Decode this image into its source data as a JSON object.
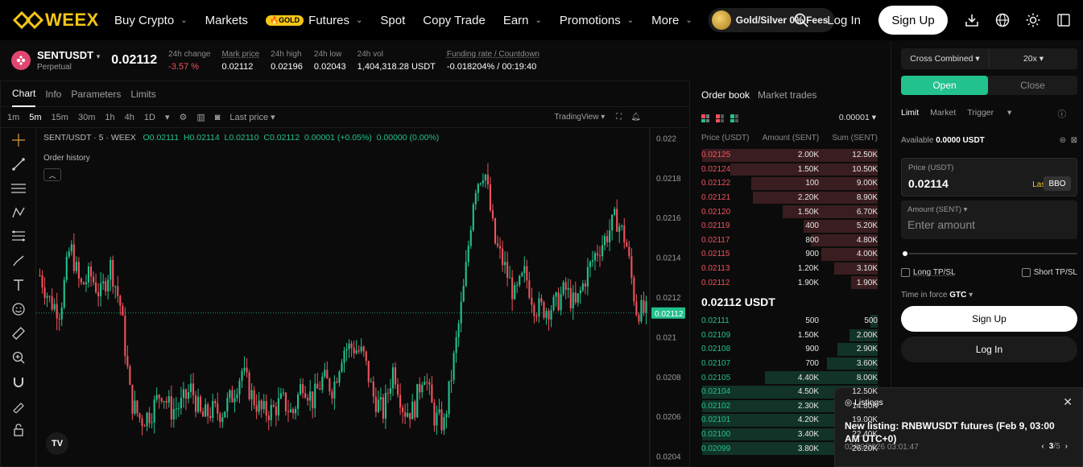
{
  "nav": {
    "logo": "WEEX",
    "items": [
      {
        "label": "Buy Crypto",
        "chevron": true
      },
      {
        "label": "Markets",
        "chevron": false
      },
      {
        "label": "Futures",
        "chevron": true,
        "badge": "🔥GOLD"
      },
      {
        "label": "Spot",
        "chevron": false
      },
      {
        "label": "Copy Trade",
        "chevron": false
      },
      {
        "label": "Earn",
        "chevron": true
      },
      {
        "label": "Promotions",
        "chevron": true
      },
      {
        "label": "More",
        "chevron": true
      }
    ],
    "promo": "Gold/Silver 0% Fees",
    "login": "Log In",
    "signup": "Sign Up"
  },
  "ticker": {
    "symbol": "SENTUSDT",
    "type": "Perpetual",
    "price": "0.02112",
    "stats": [
      {
        "label": "24h change",
        "value": "-3.57 %",
        "red": true
      },
      {
        "label": "Mark price",
        "value": "0.02112"
      },
      {
        "label": "24h high",
        "value": "0.02196"
      },
      {
        "label": "24h low",
        "value": "0.02043"
      },
      {
        "label": "24h vol",
        "value": "1,404,318.28 USDT"
      },
      {
        "label": "Funding rate / Countdown",
        "value": "-0.018204% / 00:19:40"
      }
    ]
  },
  "chart_tabs": [
    "Chart",
    "Info",
    "Parameters",
    "Limits"
  ],
  "timeframes": [
    "1m",
    "5m",
    "15m",
    "30m",
    "1h",
    "4h",
    "1D"
  ],
  "active_timeframe": "5m",
  "last_price_label": "Last price",
  "tradingview_label": "TradingView",
  "ohlc": {
    "title": "SENT/USDT · 5 · WEEX",
    "o": "O0.02111",
    "h": "H0.02114",
    "l": "L0.02110",
    "c": "C0.02112",
    "chg": "0.00001 (+0.05%)",
    "vol": "0.00000 (0.00%)"
  },
  "order_history_label": "Order history",
  "tv_logo": "TV",
  "chart_data": {
    "type": "candlestick",
    "yticks": [
      "0.022",
      "0.0218",
      "0.0216",
      "0.0214",
      "0.0212",
      "0.021",
      "0.0208",
      "0.0206",
      "0.0204"
    ],
    "ylim": [
      0.02035,
      0.02205
    ],
    "current_price": "0.02112",
    "current_value": 0.02112,
    "colors": {
      "up": "#22c18e",
      "down": "#f0525c"
    },
    "path": [
      0.02131,
      0.02118,
      0.02113,
      0.02146,
      0.02125,
      0.02131,
      0.02121,
      0.02136,
      0.02115,
      0.02068,
      0.02058,
      0.02062,
      0.02073,
      0.02063,
      0.02066,
      0.02074,
      0.02059,
      0.02063,
      0.02062,
      0.0207,
      0.02083,
      0.0207,
      0.02062,
      0.02063,
      0.02068,
      0.02061,
      0.02078,
      0.02068,
      0.02079,
      0.02074,
      0.02094,
      0.02095,
      0.02091,
      0.0207,
      0.02062,
      0.02085,
      0.02063,
      0.02063,
      0.02084,
      0.0206,
      0.02056,
      0.0209,
      0.02126,
      0.02175,
      0.02185,
      0.02148,
      0.02135,
      0.0212,
      0.02132,
      0.02115,
      0.02114,
      0.02116,
      0.02124,
      0.02115,
      0.0213,
      0.02142,
      0.0215,
      0.0216,
      0.02148,
      0.02114,
      0.02112
    ]
  },
  "orderbook": {
    "tabs": [
      "Order book",
      "Market trades"
    ],
    "tick": "0.00001",
    "headers": [
      "Price (USDT)",
      "Amount (SENT)",
      "Sum (SENT)"
    ],
    "asks": [
      {
        "p": "0.02125",
        "a": "2.00K",
        "s": "12.50K",
        "depth": 1.0
      },
      {
        "p": "0.02124",
        "a": "1.50K",
        "s": "10.50K",
        "depth": 0.84
      },
      {
        "p": "0.02122",
        "a": "100",
        "s": "9.00K",
        "depth": 0.72
      },
      {
        "p": "0.02121",
        "a": "2.20K",
        "s": "8.90K",
        "depth": 0.71
      },
      {
        "p": "0.02120",
        "a": "1.50K",
        "s": "6.70K",
        "depth": 0.54
      },
      {
        "p": "0.02119",
        "a": "400",
        "s": "5.20K",
        "depth": 0.42
      },
      {
        "p": "0.02117",
        "a": "800",
        "s": "4.80K",
        "depth": 0.38
      },
      {
        "p": "0.02115",
        "a": "900",
        "s": "4.00K",
        "depth": 0.32
      },
      {
        "p": "0.02113",
        "a": "1.20K",
        "s": "3.10K",
        "depth": 0.25
      },
      {
        "p": "0.02112",
        "a": "1.90K",
        "s": "1.90K",
        "depth": 0.15
      }
    ],
    "mid": "0.02112 USDT",
    "bids": [
      {
        "p": "0.02111",
        "a": "500",
        "s": "500",
        "depth": 0.04
      },
      {
        "p": "0.02109",
        "a": "1.50K",
        "s": "2.00K",
        "depth": 0.16
      },
      {
        "p": "0.02108",
        "a": "900",
        "s": "2.90K",
        "depth": 0.23
      },
      {
        "p": "0.02107",
        "a": "700",
        "s": "3.60K",
        "depth": 0.29
      },
      {
        "p": "0.02105",
        "a": "4.40K",
        "s": "8.00K",
        "depth": 0.64
      },
      {
        "p": "0.02104",
        "a": "4.50K",
        "s": "12.50K",
        "depth": 1.0
      },
      {
        "p": "0.02102",
        "a": "2.30K",
        "s": "14.80K",
        "depth": 1.0
      },
      {
        "p": "0.02101",
        "a": "4.20K",
        "s": "19.00K",
        "depth": 1.0
      },
      {
        "p": "0.02100",
        "a": "3.40K",
        "s": "22.40K",
        "depth": 1.0
      },
      {
        "p": "0.02099",
        "a": "3.80K",
        "s": "26.20K",
        "depth": 1.0
      }
    ]
  },
  "trade": {
    "margin_mode": "Cross Combined",
    "leverage": "20x",
    "open": "Open",
    "close": "Close",
    "order_types": [
      "Limit",
      "Market",
      "Trigger"
    ],
    "available_label": "Available",
    "available_value": "0.0000 USDT",
    "price_label": "Price (USDT)",
    "price_value": "0.02114",
    "last": "Last",
    "bbo": "BBO",
    "amount_label": "Amount (SENT)",
    "amount_placeholder": "Enter amount",
    "long_tpsl": "Long TP/SL",
    "short_tpsl": "Short TP/SL",
    "tif_label": "Time in force",
    "tif_value": "GTC",
    "signup": "Sign Up",
    "login": "Log In"
  },
  "listing": {
    "header": "Listings",
    "title": "New listing: RNBWUSDT futures (Feb 9, 03:00 AM UTC+0)",
    "date": "02/09/2026 03:01:47",
    "page": "3",
    "total": "/5"
  }
}
